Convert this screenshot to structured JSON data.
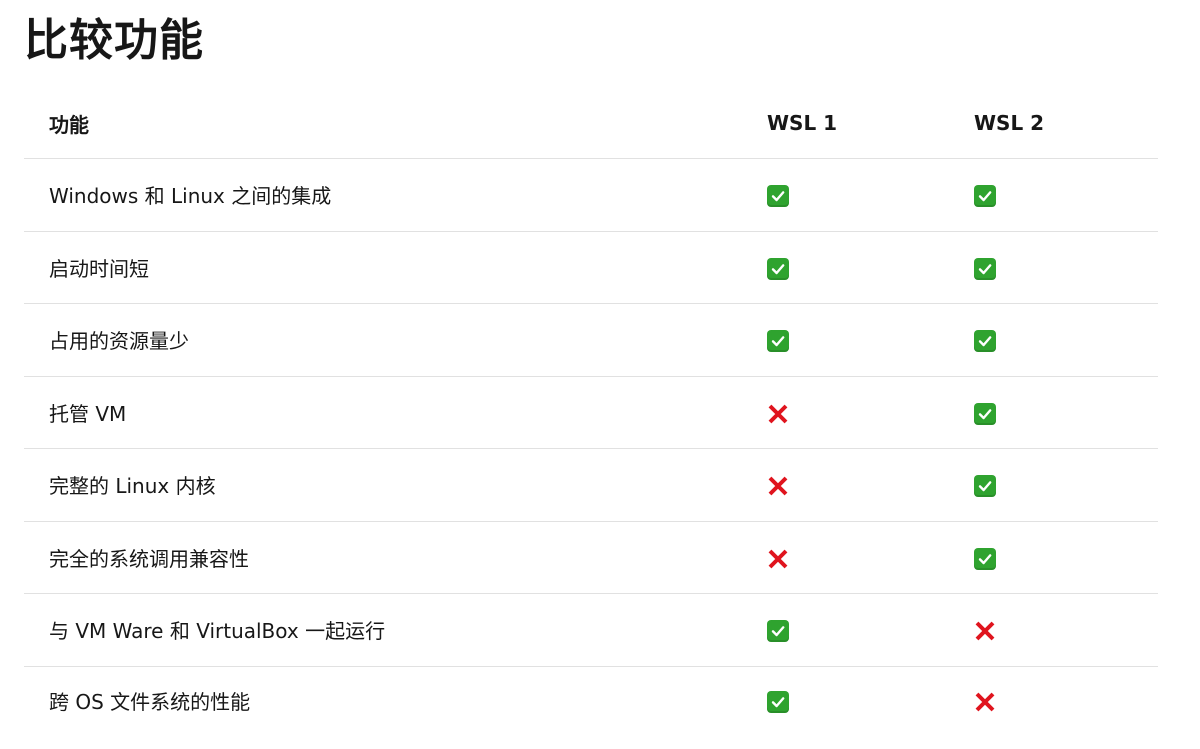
{
  "title": "比较功能",
  "table": {
    "headers": [
      "功能",
      "WSL 1",
      "WSL 2"
    ],
    "rows": [
      {
        "feature": "Windows 和 Linux 之间的集成",
        "wsl1": "yes",
        "wsl2": "yes"
      },
      {
        "feature": "启动时间短",
        "wsl1": "yes",
        "wsl2": "yes"
      },
      {
        "feature": "占用的资源量少",
        "wsl1": "yes",
        "wsl2": "yes"
      },
      {
        "feature": "托管 VM",
        "wsl1": "no",
        "wsl2": "yes"
      },
      {
        "feature": "完整的 Linux 内核",
        "wsl1": "no",
        "wsl2": "yes"
      },
      {
        "feature": "完全的系统调用兼容性",
        "wsl1": "no",
        "wsl2": "yes"
      },
      {
        "feature": "与 VM Ware 和 VirtualBox 一起运行",
        "wsl1": "yes",
        "wsl2": "no"
      },
      {
        "feature": "跨 OS 文件系统的性能",
        "wsl1": "yes",
        "wsl2": "no"
      }
    ]
  },
  "icons": {
    "yes": "check-mark-button-icon",
    "no": "cross-mark-icon"
  },
  "colors": {
    "check_bg": "#2fa32f",
    "cross": "#e0141e",
    "divider": "#e1e1e1",
    "text": "#171717"
  }
}
